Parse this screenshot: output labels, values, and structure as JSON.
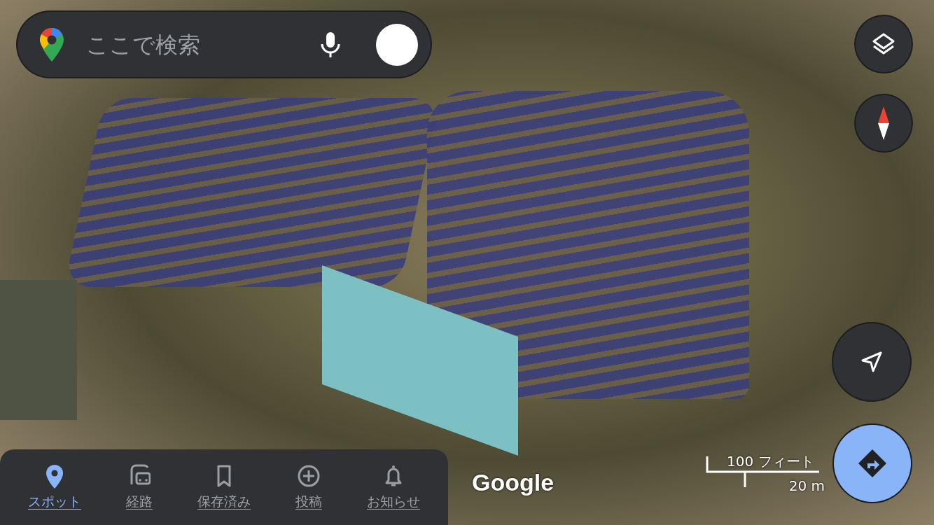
{
  "search": {
    "placeholder": "ここで検索"
  },
  "map": {
    "attribution": "Google",
    "scale": {
      "imperial": "100 フィート",
      "metric": "20 m"
    }
  },
  "nav": [
    {
      "label": "スポット",
      "kind": "pin",
      "selected": true
    },
    {
      "label": "経路",
      "kind": "commute",
      "selected": false
    },
    {
      "label": "保存済み",
      "kind": "bookmark",
      "selected": false
    },
    {
      "label": "投稿",
      "kind": "plus",
      "selected": false
    },
    {
      "label": "お知らせ",
      "kind": "bell",
      "selected": false
    }
  ]
}
